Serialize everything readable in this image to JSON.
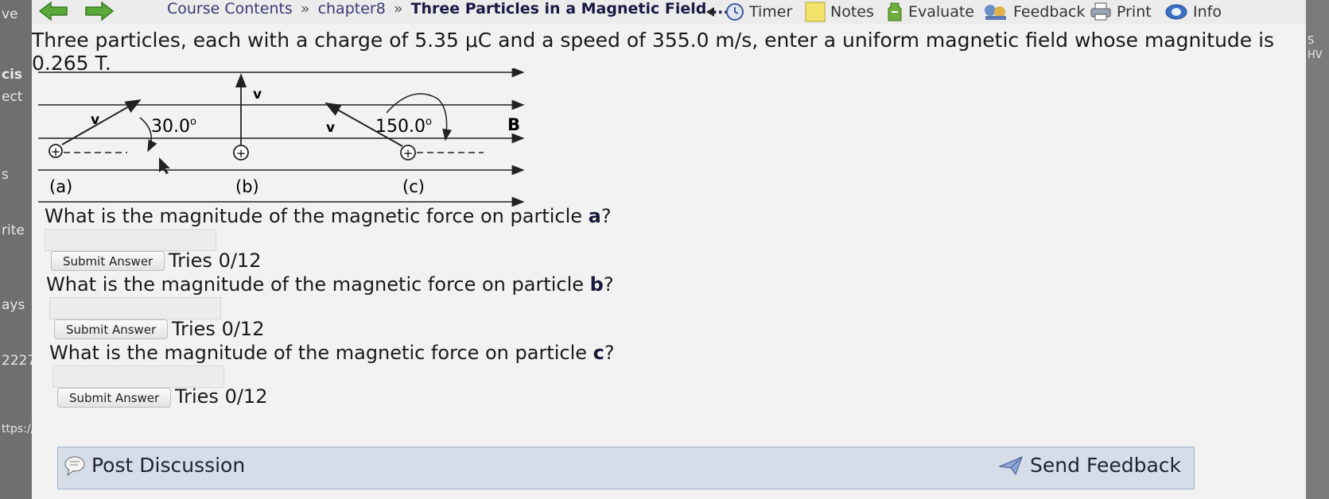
{
  "left_strip": {
    "fragments": [
      "ve",
      "cis",
      "ect",
      "s",
      "rite",
      "ays",
      "2227",
      "ttps://v"
    ]
  },
  "right_strip": {
    "fragments": [
      "S",
      "HV"
    ]
  },
  "toolbar": {
    "breadcrumb": {
      "course": "Course Contents",
      "separator": "»",
      "chapter": "chapter8",
      "current": "Three Particles in a Magnetic Field ..."
    },
    "timer_label": "Timer",
    "notes_label": "Notes",
    "evaluate_label": "Evaluate",
    "feedback_label": "Feedback",
    "print_label": "Print",
    "info_label": "Info",
    "icons": [
      "back-arrow-icon",
      "forward-arrow-icon",
      "collapse-triangle-icon",
      "timer-icon",
      "notes-icon",
      "evaluate-icon",
      "feedback-icon",
      "print-icon",
      "info-icon"
    ]
  },
  "problem": {
    "statement": "Three particles, each with a charge of 5.35 μC and a speed of 355.0 m/s, enter a uniform magnetic field whose magnitude is 0.265 T."
  },
  "diagram": {
    "angle_a": "30.0",
    "angle_c": "150.0",
    "degree": "o",
    "velocity_label": "v",
    "field_label": "B",
    "charge_symbol": "+",
    "labels": [
      "(a)",
      "(b)",
      "(c)"
    ]
  },
  "questions": [
    {
      "prefix": "What is the magnitude of the magnetic force on particle ",
      "particle": "a",
      "suffix": "?",
      "answer_value": "",
      "submit_label": "Submit Answer",
      "tries": "Tries 0/12"
    },
    {
      "prefix": "What is the magnitude of the magnetic force on particle ",
      "particle": "b",
      "suffix": "?",
      "answer_value": "",
      "submit_label": "Submit Answer",
      "tries": "Tries 0/12"
    },
    {
      "prefix": "What is the magnitude of the magnetic force on particle ",
      "particle": "c",
      "suffix": "?",
      "answer_value": "",
      "submit_label": "Submit Answer",
      "tries": "Tries 0/12"
    }
  ],
  "footer": {
    "post_discussion": "Post Discussion",
    "send_feedback": "Send Feedback"
  }
}
